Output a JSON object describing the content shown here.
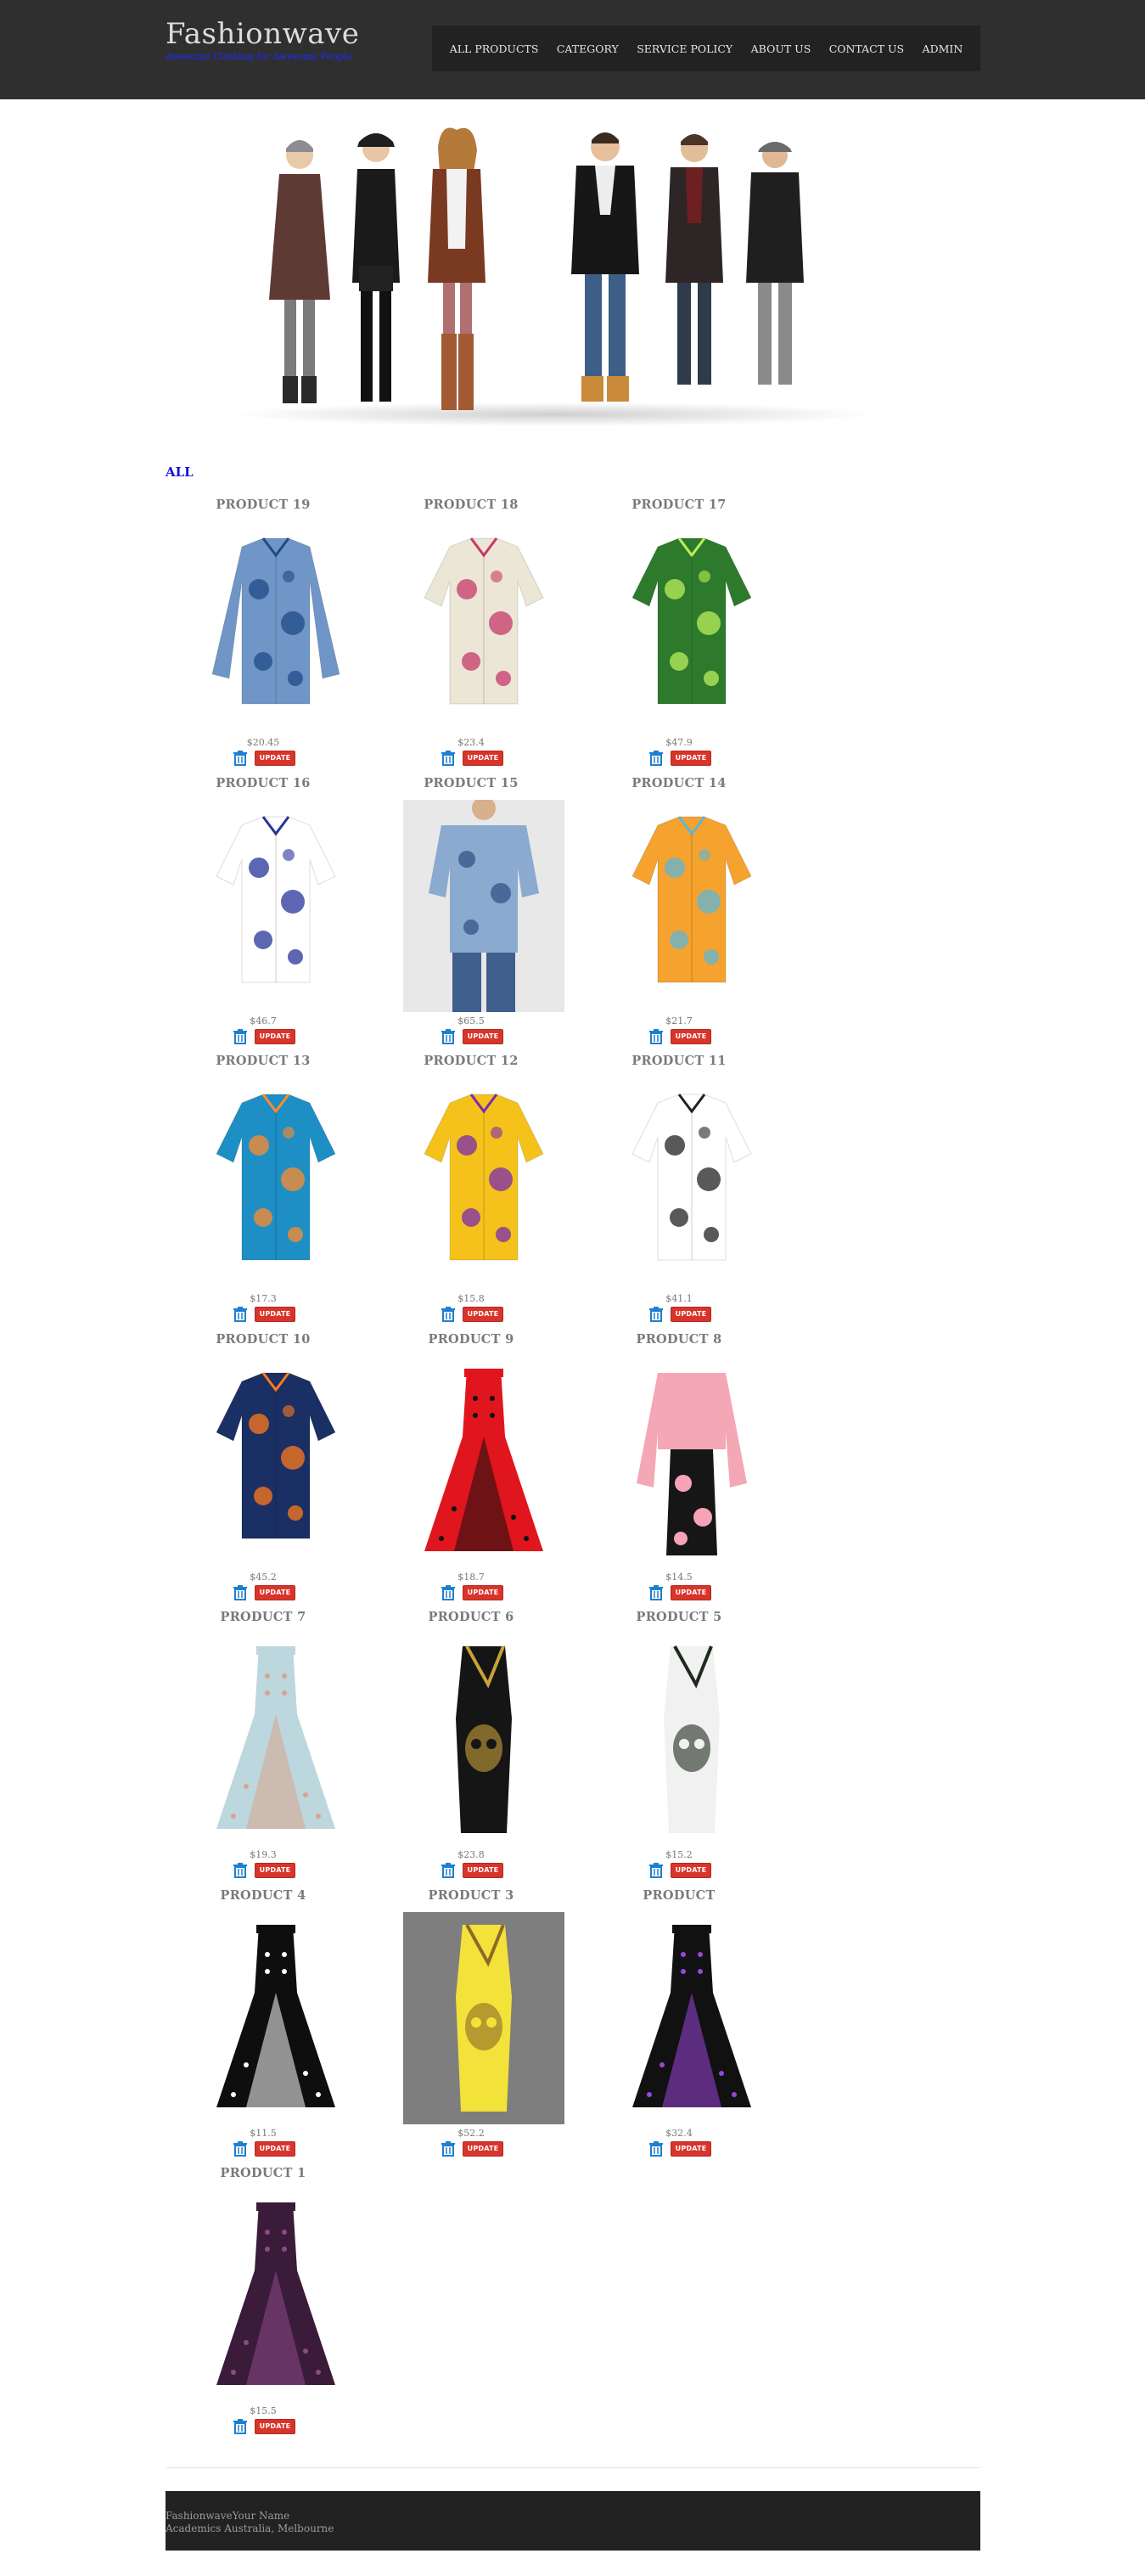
{
  "header": {
    "brand_title": "Fashionwave",
    "brand_tagline": "Awesome Clothing for Awesome People",
    "nav": [
      "ALL PRODUCTS",
      "CATEGORY",
      "SERVICE POLICY",
      "ABOUT US",
      "CONTACT US",
      "ADMIN"
    ]
  },
  "section_title": "ALL",
  "update_label": "UPDATE",
  "products": [
    {
      "name": "PRODUCT 19",
      "price": "$20.45",
      "image": "blue-paisley-long-sleeve-shirt"
    },
    {
      "name": "PRODUCT 18",
      "price": "$23.4",
      "image": "cream-floral-short-sleeve-shirt"
    },
    {
      "name": "PRODUCT 17",
      "price": "$47.9",
      "image": "green-palm-tree-shirt"
    },
    {
      "name": "PRODUCT 16",
      "price": "$46.7",
      "image": "navy-floral-shirt"
    },
    {
      "name": "PRODUCT 15",
      "price": "$65.5",
      "image": "blue-paisley-shirt-on-model"
    },
    {
      "name": "PRODUCT 14",
      "price": "$21.7",
      "image": "orange-sunset-shirt"
    },
    {
      "name": "PRODUCT 13",
      "price": "$17.3",
      "image": "teal-palm-sunset-shirt"
    },
    {
      "name": "PRODUCT 12",
      "price": "$15.8",
      "image": "colorful-geometric-shirt"
    },
    {
      "name": "PRODUCT 11",
      "price": "$41.1",
      "image": "white-palm-tree-shirt"
    },
    {
      "name": "PRODUCT 10",
      "price": "$45.2",
      "image": "navy-tropical-leaf-shirt"
    },
    {
      "name": "PRODUCT 9",
      "price": "$18.7",
      "image": "red-polka-dot-dress"
    },
    {
      "name": "PRODUCT 8",
      "price": "$14.5",
      "image": "pink-jacket-floral-dress"
    },
    {
      "name": "PRODUCT 7",
      "price": "$19.3",
      "image": "floral-halter-dress"
    },
    {
      "name": "PRODUCT 6",
      "price": "$23.8",
      "image": "black-one-shoulder-dress"
    },
    {
      "name": "PRODUCT 5",
      "price": "$15.2",
      "image": "skull-print-dress"
    },
    {
      "name": "PRODUCT 4",
      "price": "$11.5",
      "image": "black-polka-dot-dress"
    },
    {
      "name": "PRODUCT 3",
      "price": "$52.2",
      "image": "yellow-floral-dress"
    },
    {
      "name": "PRODUCT",
      "price": "$32.4",
      "image": "purple-black-dress"
    },
    {
      "name": "PRODUCT 1",
      "price": "$15.5",
      "image": "dark-purple-lace-dress"
    }
  ],
  "footer": {
    "line1": "FashionwaveYour Name",
    "line2": "Academics Australia, Melbourne"
  },
  "colors": {
    "header_bg": "#2f2f2f",
    "nav_bg": "#222222",
    "tagline": "#1c2cff",
    "section_title": "#1111dd",
    "update_button": "#d9342b",
    "delete_icon": "#1e7fd0"
  }
}
